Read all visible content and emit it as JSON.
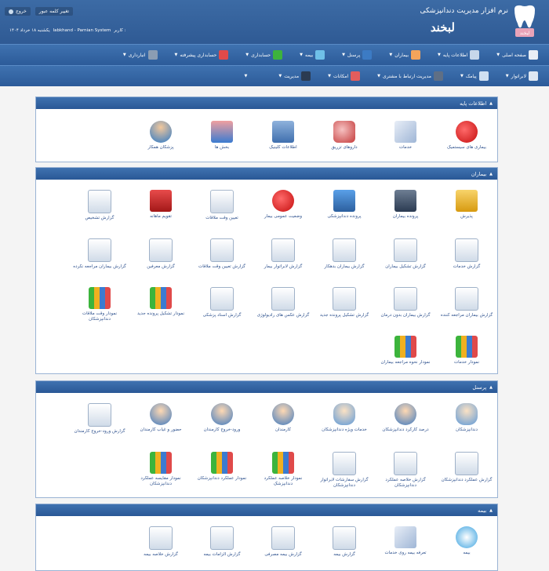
{
  "header": {
    "app_title": "نرم افزار مدیریت دندانپزشکی",
    "brand_name": "لبخند",
    "logo_text": "لبخند",
    "change_password": "تغییر کلمه عبور",
    "logout": "خروج",
    "user_label": "کاربر :",
    "user_value": "labkhand - Parnian System",
    "date": "یکشنبه ۱۸ خرداد ۱۴۰۴"
  },
  "menu1": [
    {
      "label": "صفحه اصلی",
      "icon": "home-icon",
      "color": "#e9eef6"
    },
    {
      "label": "اطلاعات پایه",
      "icon": "database-icon",
      "color": "#c7d7ea"
    },
    {
      "label": "بیماران",
      "icon": "patient-icon",
      "color": "#f3a45b"
    },
    {
      "label": "پرسنل",
      "icon": "staff-icon",
      "color": "#3c7bc4"
    },
    {
      "label": "بیمه",
      "icon": "insurance-icon",
      "color": "#6fc0e8"
    },
    {
      "label": "حسابداری",
      "icon": "accounting-icon",
      "color": "#3db33d"
    },
    {
      "label": "حسابداری پیشرفته",
      "icon": "advanced-accounting-icon",
      "color": "#e04a4a"
    },
    {
      "label": "انبارداری",
      "icon": "warehouse-icon",
      "color": "#8b9db3"
    }
  ],
  "menu2": [
    {
      "label": "لابراتوار",
      "icon": "laboratory-icon",
      "color": "#dfe8f3"
    },
    {
      "label": "پیامک",
      "icon": "sms-icon",
      "color": "#cfe0f2"
    },
    {
      "label": "مدیریت ارتباط با مشتری",
      "icon": "crm-icon",
      "color": "#5f6f85"
    },
    {
      "label": "امکانات",
      "icon": "tools-icon",
      "color": "#e25d5d"
    },
    {
      "label": "مدیریت",
      "icon": "admin-icon",
      "color": "#2b3b52"
    },
    {
      "label": "",
      "icon": "more-icon",
      "color": "transparent"
    }
  ],
  "sections": [
    {
      "title": "اطلاعات پایه",
      "items": [
        {
          "label": "بیماری های سیستمیک",
          "icon": "medical-star-icon",
          "style": "c1"
        },
        {
          "label": "خدمات",
          "icon": "dental-tools-icon",
          "style": "c2"
        },
        {
          "label": "داروهای تزریق",
          "icon": "pills-icon",
          "style": "c3"
        },
        {
          "label": "اطلاعات کلینیک",
          "icon": "clinic-icon",
          "style": "c4"
        },
        {
          "label": "بخش ها",
          "icon": "hospital-icon",
          "style": "c5"
        },
        {
          "label": "پزشکان همکار",
          "icon": "doctor-icon",
          "style": "c6"
        }
      ]
    },
    {
      "title": "بیماران",
      "items": [
        {
          "label": "پذیرش",
          "icon": "reception-icon",
          "style": "c7"
        },
        {
          "label": "پرونده بیماران",
          "icon": "server-icon",
          "style": "c8"
        },
        {
          "label": "پرونده دندانپزشکی",
          "icon": "folder-icon",
          "style": "c9"
        },
        {
          "label": "وضعیت عمومی بیمار",
          "icon": "medical-star-icon",
          "style": "c1"
        },
        {
          "label": "تعیین وقت ملاقات",
          "icon": "calendar-icon",
          "style": "c10"
        },
        {
          "label": "تقویم ماهانه",
          "icon": "monthly-calendar-icon",
          "style": "c11"
        },
        {
          "label": "گزارش تشخیص",
          "icon": "diagnosis-report-icon",
          "style": "c12"
        },
        {
          "label": "گزارش خدمات",
          "icon": "services-report-icon",
          "style": "c12"
        },
        {
          "label": "گزارش تشکیل بیماران",
          "icon": "patients-report-icon",
          "style": "c12"
        },
        {
          "label": "گزارش بیماران بدهکار",
          "icon": "debtors-report-icon",
          "style": "c12"
        },
        {
          "label": "گزارش لابراتوار بیمار",
          "icon": "lab-report-icon",
          "style": "c12"
        },
        {
          "label": "گزارش تعیین وقت ملاقات",
          "icon": "appointment-report-icon",
          "style": "c12"
        },
        {
          "label": "گزارش معرفین",
          "icon": "referrers-report-icon",
          "style": "c12"
        },
        {
          "label": "گزارش بیماران مراجعه نکرده",
          "icon": "no-show-report-icon",
          "style": "c12"
        },
        {
          "label": "گزارش بیماران مراجعه کننده",
          "icon": "visitors-report-icon",
          "style": "c12"
        },
        {
          "label": "گزارش بیماران بدون درمان",
          "icon": "untreated-report-icon",
          "style": "c12"
        },
        {
          "label": "گزارش تشکیل پرونده جدید",
          "icon": "new-file-report-icon",
          "style": "c12"
        },
        {
          "label": "گزارش عکس های رادیولوژی",
          "icon": "radiology-report-icon",
          "style": "c12"
        },
        {
          "label": "گزارش اسناد پزشکی",
          "icon": "medical-docs-report-icon",
          "style": "c12"
        },
        {
          "label": "نمودار تشکیل پرونده جدید",
          "icon": "chart-icon",
          "style": "c13"
        },
        {
          "label": "نمودار وقت ملاقات دندانپزشکان",
          "icon": "chart-icon",
          "style": "c13"
        },
        {
          "label": "نمودار خدمات",
          "icon": "chart-icon",
          "style": "c13"
        },
        {
          "label": "نمودار نحوه مراجعه بیماران",
          "icon": "chart-icon",
          "style": "c13"
        }
      ]
    },
    {
      "title": "پرسنل",
      "items": [
        {
          "label": "دندانپزشکان",
          "icon": "dentist-icon",
          "style": "c15"
        },
        {
          "label": "درصد کارکرد دندانپزشکان",
          "icon": "percentage-icon",
          "style": "c14"
        },
        {
          "label": "خدمات ویژه دندانپزشکان",
          "icon": "special-services-icon",
          "style": "c15"
        },
        {
          "label": "کارمندان",
          "icon": "employees-icon",
          "style": "c14"
        },
        {
          "label": "ورود-خروج کارمندان",
          "icon": "attendance-icon",
          "style": "c14"
        },
        {
          "label": "حضور و غیاب کارمندان",
          "icon": "presence-icon",
          "style": "c14"
        },
        {
          "label": "گزارش ورود-خروج کارمندان",
          "icon": "attendance-report-icon",
          "style": "c12"
        },
        {
          "label": "گزارش عملکرد دندانپزشکان",
          "icon": "performance-report-icon",
          "style": "c12"
        },
        {
          "label": "گزارش خلاصه عملکرد دندانپزشکان",
          "icon": "summary-report-icon",
          "style": "c12"
        },
        {
          "label": "گزارش سفارشات لابراتوار دندانپزشکان",
          "icon": "lab-orders-report-icon",
          "style": "c12"
        },
        {
          "label": "نمودار خلاصه عملکرد دندانپزشک",
          "icon": "chart-icon",
          "style": "c13"
        },
        {
          "label": "نمودار عملکرد دندانپزشکان",
          "icon": "chart-icon",
          "style": "c13"
        },
        {
          "label": "نمودار مقایسه عملکرد دندانپزشکان",
          "icon": "chart-icon",
          "style": "c13"
        }
      ]
    },
    {
      "title": "بیمه",
      "items": [
        {
          "label": "بیمه",
          "icon": "insurance-icon",
          "style": "c16"
        },
        {
          "label": "تعرفه بیمه روی خدمات",
          "icon": "tariff-icon",
          "style": "c2"
        },
        {
          "label": "گزارش بیمه",
          "icon": "insurance-report-icon",
          "style": "c12"
        },
        {
          "label": "گزارش بیمه مصرفی",
          "icon": "consumed-insurance-report-icon",
          "style": "c12"
        },
        {
          "label": "گزارش الزامات بیمه",
          "icon": "insurance-requirements-report-icon",
          "style": "c12"
        },
        {
          "label": "گزارش خلاصه بیمه",
          "icon": "insurance-summary-report-icon",
          "style": "c12"
        }
      ]
    }
  ]
}
